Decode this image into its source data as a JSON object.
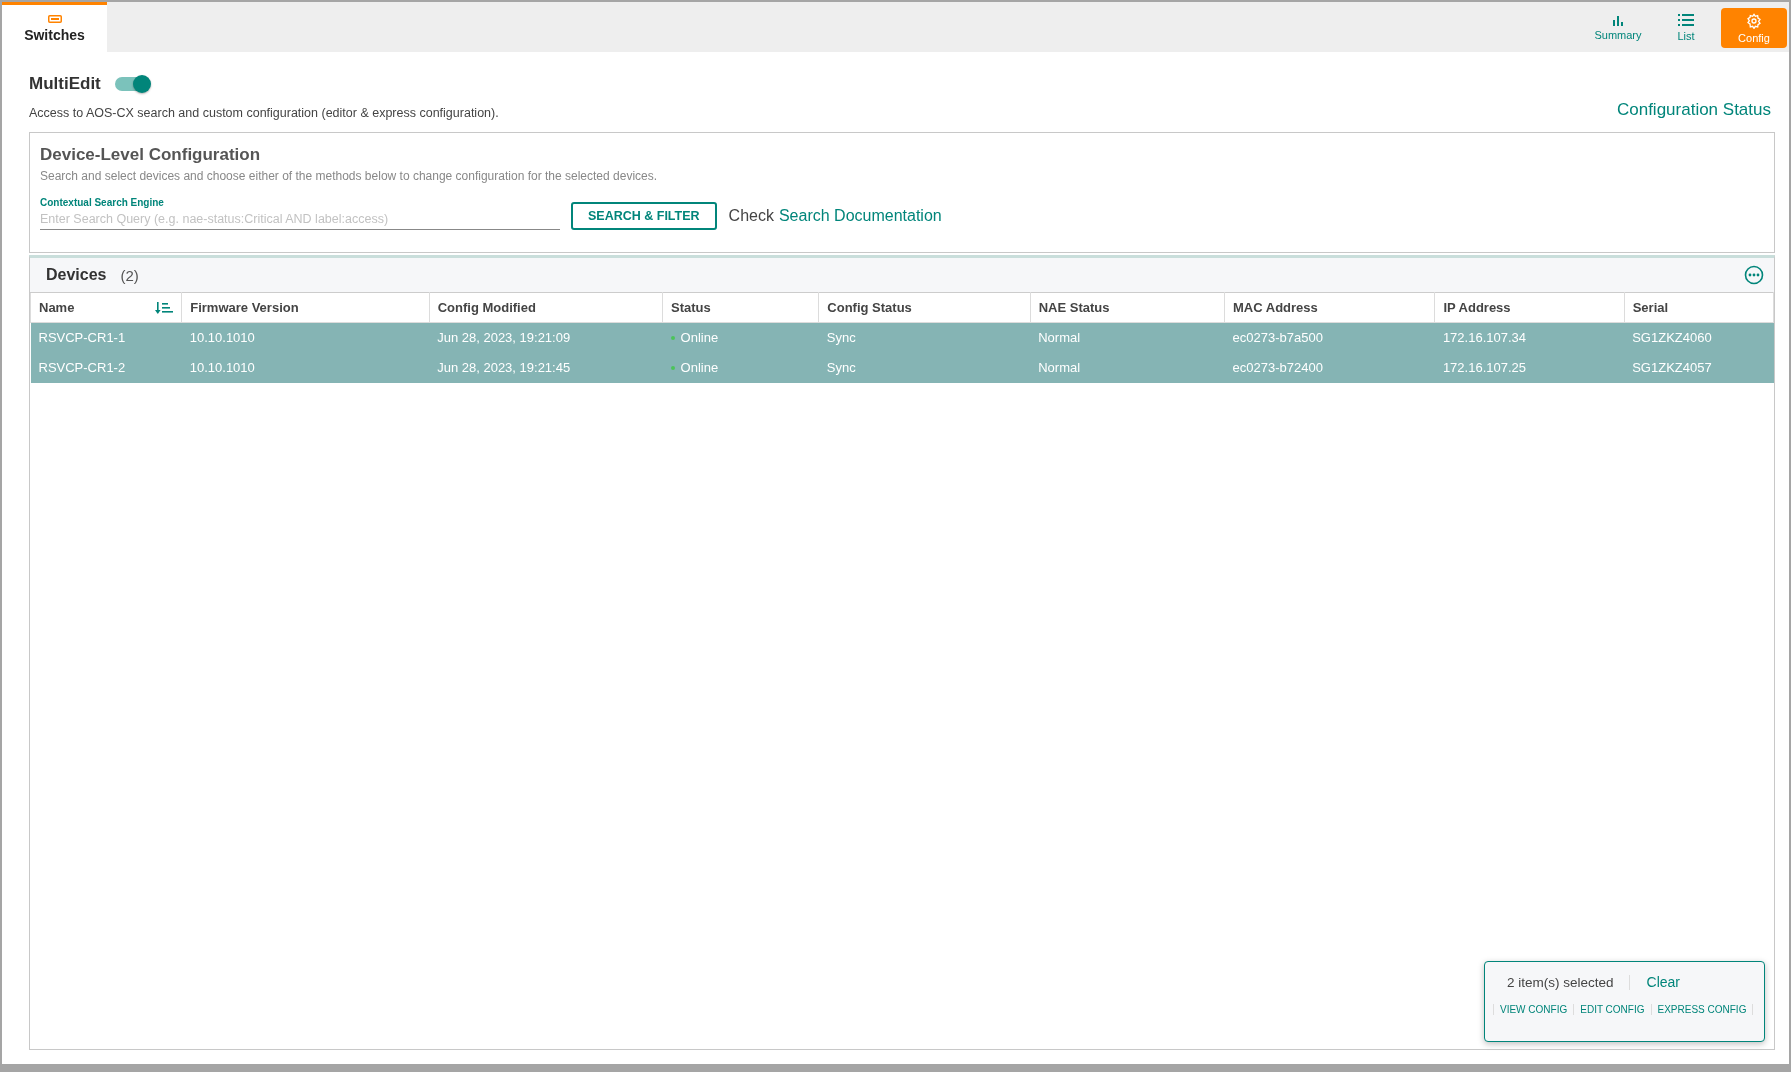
{
  "top_tabs": [
    {
      "label": "Switches",
      "selected": true
    }
  ],
  "view_buttons": [
    {
      "kind": "summary",
      "label": "Summary",
      "selected": false
    },
    {
      "kind": "list",
      "label": "List",
      "selected": false
    },
    {
      "kind": "config",
      "label": "Config",
      "selected": true
    }
  ],
  "multiedit": {
    "label": "MultiEdit",
    "on": true,
    "description": "Access to AOS-CX search and custom configuration (editor & express configuration).",
    "status_link": "Configuration Status"
  },
  "device_config": {
    "title": "Device-Level Configuration",
    "subtitle": "Search and select devices and choose either of the methods below to change configuration for the selected devices.",
    "search_label": "Contextual Search Engine",
    "placeholder": "Enter Search Query (e.g. nae-status:Critical AND label:access)",
    "button": "SEARCH & FILTER",
    "check_text": "Check",
    "doc_link": "Search Documentation"
  },
  "devices": {
    "title": "Devices",
    "count": "(2)",
    "columns": [
      "Name",
      "Firmware Version",
      "Config Modified",
      "Status",
      "Config Status",
      "NAE Status",
      "MAC Address",
      "IP Address",
      "Serial"
    ],
    "rows": [
      {
        "selected": true,
        "cells": [
          "RSVCP-CR1-1",
          "10.10.1010",
          "Jun 28, 2023, 19:21:09",
          "Online",
          "Sync",
          "Normal",
          "ec0273-b7a500",
          "172.16.107.34",
          "SG1ZKZ4060"
        ],
        "color": "#4cc35a"
      },
      {
        "selected": true,
        "cells": [
          "RSVCP-CR1-2",
          "10.10.1010",
          "Jun 28, 2023, 19:21:45",
          "Online",
          "Sync",
          "Normal",
          "ec0273-b72400",
          "172.16.107.25",
          "SG1ZKZ4057"
        ],
        "color": "#4cc35a"
      }
    ]
  },
  "selection_bar": {
    "count": "2 item(s) selected",
    "clear": "Clear",
    "actions": [
      "VIEW CONFIG",
      "EDIT CONFIG",
      "EXPRESS CONFIG"
    ]
  }
}
